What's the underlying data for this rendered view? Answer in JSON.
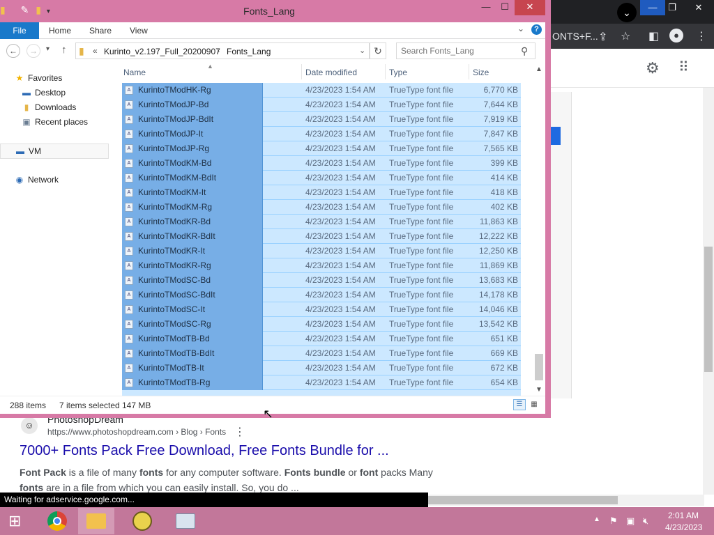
{
  "chrome": {
    "tab_text": "ONTS+F...",
    "minimize_label": "—",
    "restore_label": "❐",
    "close_label": "✕",
    "gear_icon": "⚙",
    "apps_icon": "⠿"
  },
  "search_result": {
    "site_name": "PhotoshopDream",
    "url": "https://www.photoshopdream.com › Blog › Fonts",
    "title": "7000+ Fonts Pack Free Download, Free Fonts Bundle for ...",
    "snippet_line1_parts": [
      "Font Pack",
      " is a file of many ",
      "fonts",
      " for any computer software. ",
      "Fonts bundle",
      " or ",
      "font",
      " packs Many"
    ],
    "snippet_line2_parts": [
      "fonts",
      " are in a file from which you can easily install. So, you do ..."
    ]
  },
  "browser_status": "Waiting for adservice.google.com...",
  "explorer": {
    "title": "Fonts_Lang",
    "ribbon": {
      "file": "File",
      "home": "Home",
      "share": "Share",
      "view": "View"
    },
    "address": {
      "overflow": "«",
      "crumb1": "Kurinto_v2.197_Full_20200907",
      "separator": "›",
      "crumb2": "Fonts_Lang"
    },
    "search_placeholder": "Search Fonts_Lang",
    "nav_pane": {
      "favorites": "Favorites",
      "desktop": "Desktop",
      "downloads": "Downloads",
      "recent_places": "Recent places",
      "vm": "VM",
      "network": "Network"
    },
    "columns": {
      "name": "Name",
      "date": "Date modified",
      "type": "Type",
      "size": "Size"
    },
    "files": [
      {
        "name": "KurintoTModHK-Rg",
        "date": "4/23/2023 1:54 AM",
        "type": "TrueType font file",
        "size": "6,770 KB"
      },
      {
        "name": "KurintoTModJP-Bd",
        "date": "4/23/2023 1:54 AM",
        "type": "TrueType font file",
        "size": "7,644 KB"
      },
      {
        "name": "KurintoTModJP-BdIt",
        "date": "4/23/2023 1:54 AM",
        "type": "TrueType font file",
        "size": "7,919 KB"
      },
      {
        "name": "KurintoTModJP-It",
        "date": "4/23/2023 1:54 AM",
        "type": "TrueType font file",
        "size": "7,847 KB"
      },
      {
        "name": "KurintoTModJP-Rg",
        "date": "4/23/2023 1:54 AM",
        "type": "TrueType font file",
        "size": "7,565 KB"
      },
      {
        "name": "KurintoTModKM-Bd",
        "date": "4/23/2023 1:54 AM",
        "type": "TrueType font file",
        "size": "399 KB"
      },
      {
        "name": "KurintoTModKM-BdIt",
        "date": "4/23/2023 1:54 AM",
        "type": "TrueType font file",
        "size": "414 KB"
      },
      {
        "name": "KurintoTModKM-It",
        "date": "4/23/2023 1:54 AM",
        "type": "TrueType font file",
        "size": "418 KB"
      },
      {
        "name": "KurintoTModKM-Rg",
        "date": "4/23/2023 1:54 AM",
        "type": "TrueType font file",
        "size": "402 KB"
      },
      {
        "name": "KurintoTModKR-Bd",
        "date": "4/23/2023 1:54 AM",
        "type": "TrueType font file",
        "size": "11,863 KB"
      },
      {
        "name": "KurintoTModKR-BdIt",
        "date": "4/23/2023 1:54 AM",
        "type": "TrueType font file",
        "size": "12,222 KB"
      },
      {
        "name": "KurintoTModKR-It",
        "date": "4/23/2023 1:54 AM",
        "type": "TrueType font file",
        "size": "12,250 KB"
      },
      {
        "name": "KurintoTModKR-Rg",
        "date": "4/23/2023 1:54 AM",
        "type": "TrueType font file",
        "size": "11,869 KB"
      },
      {
        "name": "KurintoTModSC-Bd",
        "date": "4/23/2023 1:54 AM",
        "type": "TrueType font file",
        "size": "13,683 KB"
      },
      {
        "name": "KurintoTModSC-BdIt",
        "date": "4/23/2023 1:54 AM",
        "type": "TrueType font file",
        "size": "14,178 KB"
      },
      {
        "name": "KurintoTModSC-It",
        "date": "4/23/2023 1:54 AM",
        "type": "TrueType font file",
        "size": "14,046 KB"
      },
      {
        "name": "KurintoTModSC-Rg",
        "date": "4/23/2023 1:54 AM",
        "type": "TrueType font file",
        "size": "13,542 KB"
      },
      {
        "name": "KurintoTModTB-Bd",
        "date": "4/23/2023 1:54 AM",
        "type": "TrueType font file",
        "size": "651 KB"
      },
      {
        "name": "KurintoTModTB-BdIt",
        "date": "4/23/2023 1:54 AM",
        "type": "TrueType font file",
        "size": "669 KB"
      },
      {
        "name": "KurintoTModTB-It",
        "date": "4/23/2023 1:54 AM",
        "type": "TrueType font file",
        "size": "672 KB"
      },
      {
        "name": "KurintoTModTB-Rg",
        "date": "4/23/2023 1:54 AM",
        "type": "TrueType font file",
        "size": "654 KB"
      }
    ],
    "status": {
      "item_count": "288 items",
      "selected": "7 items selected",
      "selected_size": "147 MB"
    }
  },
  "taskbar": {
    "time": "2:01 AM",
    "date": "4/23/2023"
  },
  "colors": {
    "explorer_frame": "#d77aa6",
    "taskbar": "#c2779a",
    "selection": "#cce8ff",
    "file_tab": "#1979ca"
  }
}
